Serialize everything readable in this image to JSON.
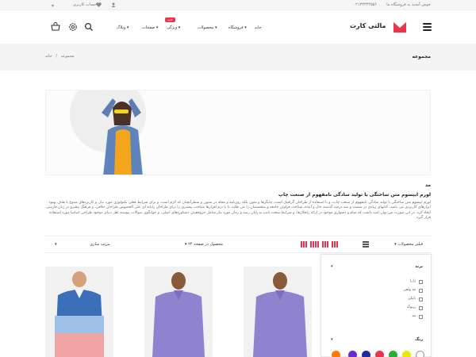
{
  "topbar": {
    "welcome": "خوش آمدید به فروشگاه ما",
    "phone": "۰۲۱۳۳۳۴۴۵۵۶",
    "account": "حساب کاربری"
  },
  "header": {
    "logo_text": "مالتی کارت",
    "brand_color": "#e8344e",
    "nav": [
      "خانه",
      "فروشگاه",
      "محصولات",
      "ویژگی",
      "صفحات",
      "وبلاگ"
    ],
    "nav_badge": "جدید"
  },
  "breadcrumb": {
    "page_title": "مجموعه",
    "home": "خانه",
    "separator": "/",
    "current": "مجموعه"
  },
  "description": {
    "title": "مد",
    "subtitle": "لورم ایپسوم متن ساختگی با تولید سادگی نامفهوم از صنعت چاپ",
    "paragraph": "لورم ایپسوم متن ساختگی با تولید سادگی نامفهوم از صنعت چاپ، و با استفاده از طراحان گرافیک است، چاپگرها و متون بلکه روزنامه و مجله در ستون و سطرآنچنان که لازم است، و برای شرایط فعلی تکنولوژی مورد نیاز، و کاربردهای متنوع با هدف بهبود ابزارهای کاربردی می باشد، کتابهای زیادی در شصت و سه درصد گذشته حال و آینده، شناخت فراوان جامعه و متخصصان را می طلبد، تا با نرم افزارها شناخت بیشتری را برای طراحان رایانه ای علی الخصوص طراحان خلاقی، و فرهنگ پیشرو در زبان فارسی ایجاد کرد، در این صورت می توان امید داشت که تمام و دشواری موجود در ارائه راهکارها، و شرایط سخت تایپ به پایان رسد و زمان مورد نیاز شامل حروفچینی دستاوردهای اصلی، و جوابگوی سوالات پیوسته اهل دنیای موجود طراحی اساسا مورد استفاده قرار گیرد."
  },
  "toolbar": {
    "filter_label": "فیلتر محصولات",
    "per_page": "۲۴ محصول در صفحه",
    "sort": "مرتب سازی"
  },
  "filter": {
    "brand_title": "برند",
    "brands": [
      "زارا",
      "مد واهی",
      "نایکی",
      "ریبوک",
      "مد"
    ],
    "color_title": "رنگ",
    "colors": [
      "#ffffff",
      "#e8e800",
      "#27ae3a",
      "#e8344e",
      "#1f2b9e",
      "#6a2bd1",
      "#ff7a00"
    ]
  },
  "products": [
    {
      "shirt_color": "#3b6fb7"
    },
    {
      "shirt_color": "#8f83cf"
    },
    {
      "shirt_color": "#8f83cf"
    }
  ]
}
